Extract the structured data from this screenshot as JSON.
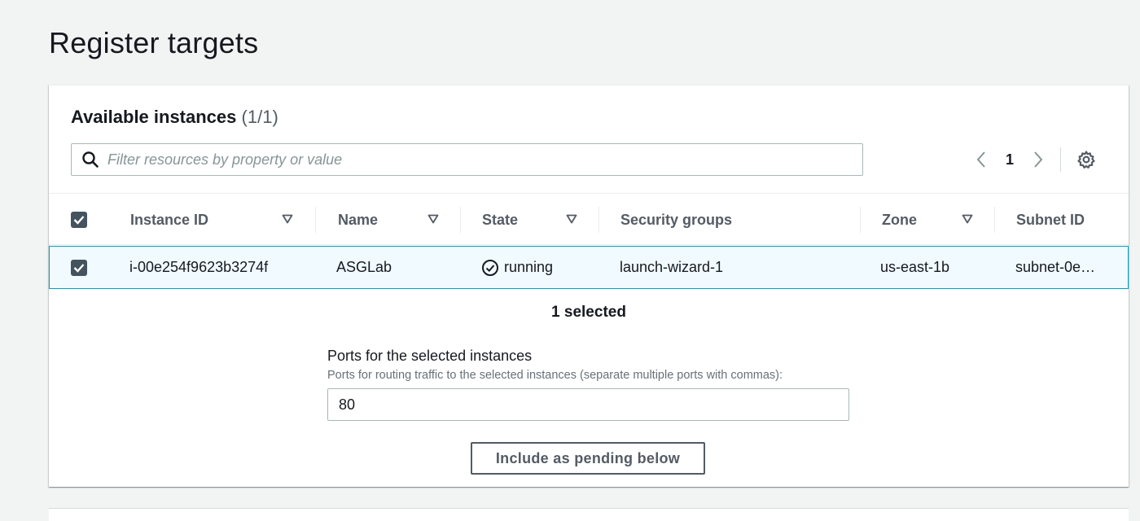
{
  "page": {
    "title": "Register targets"
  },
  "panel": {
    "title": "Available instances",
    "count": "(1/1)"
  },
  "filter": {
    "placeholder": "Filter resources by property or value",
    "icon": "search-icon"
  },
  "pagination": {
    "current_page": "1"
  },
  "table": {
    "columns": [
      "Instance ID",
      "Name",
      "State",
      "Security groups",
      "Zone",
      "Subnet ID"
    ],
    "rows": [
      {
        "selected": true,
        "instance_id": "i-00e254f9623b3274f",
        "name": "ASGLab",
        "state": "running",
        "security_groups": "launch-wizard-1",
        "zone": "us-east-1b",
        "subnet_id": "subnet-0e…"
      }
    ]
  },
  "selection": {
    "summary": "1 selected"
  },
  "ports": {
    "label": "Ports for the selected instances",
    "description": "Ports for routing traffic to the selected instances (separate multiple ports with commas):",
    "value": "80"
  },
  "actions": {
    "include_label": "Include as pending below"
  },
  "colors": {
    "accent": "#00a1c9",
    "selected_row_bg": "#f1faff",
    "checkbox": "#44535e",
    "page_bg": "#f2f3f3"
  }
}
